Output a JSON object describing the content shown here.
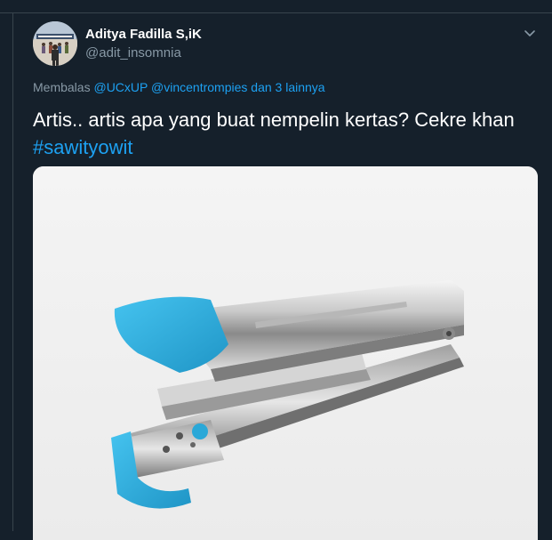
{
  "tweet": {
    "author": {
      "display_name": "Aditya Fadilla S,iK",
      "handle": "@adit_insomnia"
    },
    "reply": {
      "prefix": "Membalas",
      "mention_1": "@UCxUP",
      "mention_2": "@vincentrompies",
      "suffix": "dan 3 lainnya"
    },
    "text": "Artis.. artis apa yang buat nempelin kertas? Cekre khan",
    "hashtag": "#sawityowit",
    "media": {
      "subject": "stapler",
      "accent_color": "#2aa8d8"
    }
  },
  "colors": {
    "background": "#15202b",
    "link": "#1da1f2",
    "secondary_text": "#8899a6",
    "border": "#38444d"
  },
  "icons": {
    "menu": "chevron-down-icon"
  }
}
